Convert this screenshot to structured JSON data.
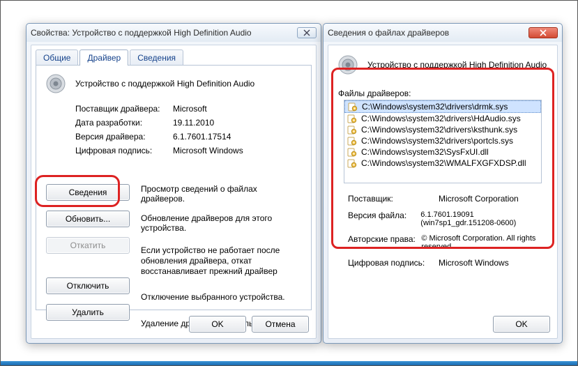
{
  "left": {
    "title": "Свойства: Устройство с поддержкой High Definition Audio",
    "tabs": {
      "general": "Общие",
      "driver": "Драйвер",
      "details": "Сведения"
    },
    "device_name": "Устройство с поддержкой High Definition Audio",
    "fields": {
      "vendor_label": "Поставщик драйвера:",
      "vendor_value": "Microsoft",
      "date_label": "Дата разработки:",
      "date_value": "19.11.2010",
      "version_label": "Версия драйвера:",
      "version_value": "6.1.7601.17514",
      "sign_label": "Цифровая подпись:",
      "sign_value": "Microsoft Windows"
    },
    "buttons": {
      "details": "Сведения",
      "update": "Обновить...",
      "rollback": "Откатить",
      "disable": "Отключить",
      "uninstall": "Удалить"
    },
    "descriptions": {
      "details": "Просмотр сведений о файлах драйверов.",
      "update": "Обновление драйверов для этого устройства.",
      "rollback": "Если устройство не работает после обновления драйвера, откат восстанавливает прежний драйвер",
      "disable": "Отключение выбранного устройства.",
      "uninstall": "Удаление драйвера (для опытных)."
    },
    "ok": "OK",
    "cancel": "Отмена"
  },
  "right": {
    "title": "Сведения о файлах драйверов",
    "device_name": "Устройство с поддержкой High Definition Audio",
    "files_label": "Файлы драйверов:",
    "files": [
      "C:\\Windows\\system32\\drivers\\drmk.sys",
      "C:\\Windows\\system32\\drivers\\HdAudio.sys",
      "C:\\Windows\\system32\\drivers\\ksthunk.sys",
      "C:\\Windows\\system32\\drivers\\portcls.sys",
      "C:\\Windows\\system32\\SysFxUI.dll",
      "C:\\Windows\\system32\\WMALFXGFXDSP.dll"
    ],
    "meta": {
      "vendor_label": "Поставщик:",
      "vendor_value": "Microsoft Corporation",
      "filever_label": "Версия файла:",
      "filever_value": "6.1.7601.19091 (win7sp1_gdr.151208-0600)",
      "copyright_label": "Авторские права:",
      "copyright_value": "© Microsoft Corporation. All rights reserved.",
      "sign_label": "Цифровая подпись:",
      "sign_value": "Microsoft Windows"
    },
    "ok": "OK"
  }
}
